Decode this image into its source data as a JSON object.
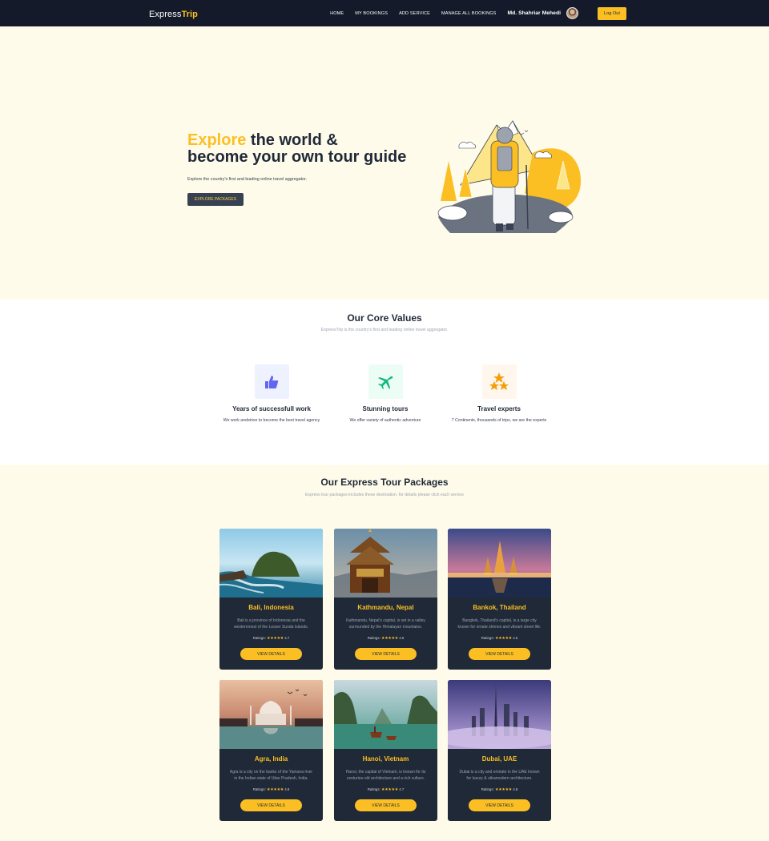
{
  "nav": {
    "brand_primary": "Express",
    "brand_accent": "Trip",
    "links": [
      "HOME",
      "MY BOOKINGS",
      "ADD SERVICE",
      "MANAGE ALL BOOKINGS"
    ],
    "user_name": "Md. Shahriar Mehedi",
    "logout_label": "Log Out"
  },
  "hero": {
    "title_highlight": "Explore",
    "title_rest_line1": " the world &",
    "title_line2": "become your own tour guide",
    "subtitle": "Explore the country's first and leading online travel aggregator.",
    "button_label": "EXPLORE PACKAGES"
  },
  "core_values": {
    "title": "Our Core Values",
    "subtitle": "ExpressTrip is the country's first and leading online travel aggregator.",
    "items": [
      {
        "title": "Years of successfull work",
        "text": "We work andstrive to become the best travel agency",
        "icon": "thumbs-up-icon",
        "color": "#6366f1",
        "bg": "#eef2ff"
      },
      {
        "title": "Stunning tours",
        "text": "We offer variety of authentic adventure",
        "icon": "plane-icon",
        "color": "#10b981",
        "bg": "#ecfdf5"
      },
      {
        "title": "Travel experts",
        "text": "7 Continents, thousands of trips, we are the experts",
        "icon": "stars-icon",
        "color": "#f59e0b",
        "bg": "#fff7ed"
      }
    ]
  },
  "packages": {
    "title": "Our Express Tour Packages",
    "subtitle": "Express tour packages includes these destination, for details please click each service",
    "cards": [
      {
        "title": "Bali, Indonesia",
        "desc": "Bali is a province of Indonesia and the westernmost of the Lesser Sunda Islands.",
        "ratings_label": "Ratings:",
        "stars": "★★★★★",
        "rating": "4.7",
        "button": "VIEW DETAILS"
      },
      {
        "title": "Kathmandu, Nepal",
        "desc": "Kathmandu, Nepal's capital, is set in a valley surrounded by the Himalayan mountains.",
        "ratings_label": "Ratings:",
        "stars": "★★★★★",
        "rating": "4.6",
        "button": "VIEW DETAILS"
      },
      {
        "title": "Bankok, Thailand",
        "desc": "Bangkok, Thailand's capital, is a large city known for ornate shrines and vibrant street life.",
        "ratings_label": "Ratings:",
        "stars": "★★★★★",
        "rating": "4.5",
        "button": "VIEW DETAILS"
      },
      {
        "title": "Agra, India",
        "desc": "Agra is a city on the banks of the Yamuna river in the Indian state of Uttar Pradesh, India.",
        "ratings_label": "Ratings:",
        "stars": "★★★★★",
        "rating": "4.8",
        "button": "VIEW DETAILS"
      },
      {
        "title": "Hanoi, Vietnam",
        "desc": "Hanoi, the capital of Vietnam, is known for its centuries-old architecture and a rich culture.",
        "ratings_label": "Ratings:",
        "stars": "★★★★★",
        "rating": "4.7",
        "button": "VIEW DETAILS"
      },
      {
        "title": "Dubai, UAE",
        "desc": "Dubai is a city and emirate in the UAE known for luxury & ultramodern architecture.",
        "ratings_label": "Ratings:",
        "stars": "★★★★★",
        "rating": "4.8",
        "button": "VIEW DETAILS"
      }
    ]
  },
  "colors": {
    "accent": "#fbbf24",
    "nav_bg": "#141a29",
    "card_bg": "#1f2937",
    "cream_bg": "#fffbea"
  }
}
